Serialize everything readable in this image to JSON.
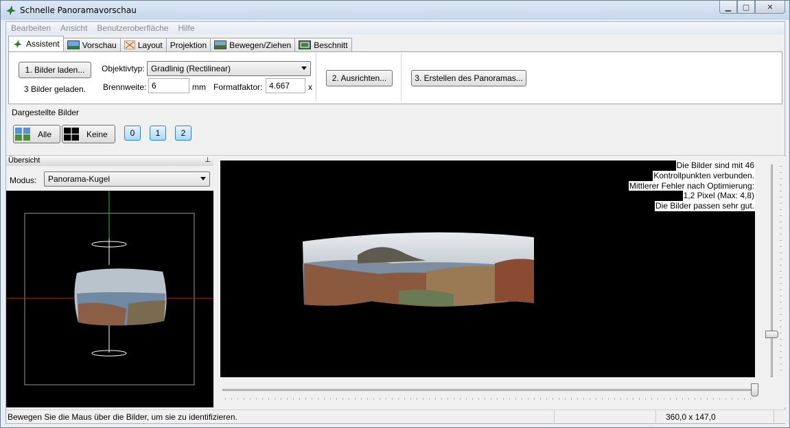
{
  "window": {
    "title": "Schnelle Panoramavorschau",
    "controls": {
      "minimize": "▁",
      "maximize": "▢",
      "close": "✕"
    }
  },
  "menubar": {
    "items": [
      "Bearbeiten",
      "Ansicht",
      "Benutzeroberfläche",
      "Hilfe"
    ]
  },
  "tabs": [
    {
      "label": "Assistent",
      "icon": "hugin-icon",
      "active": true
    },
    {
      "label": "Vorschau",
      "icon": "preview-landscape-icon"
    },
    {
      "label": "Layout",
      "icon": "layout-icon"
    },
    {
      "label": "Projektion",
      "icon": ""
    },
    {
      "label": "Bewegen/Ziehen",
      "icon": "move-drag-icon"
    },
    {
      "label": "Beschnitt",
      "icon": "crop-icon"
    }
  ],
  "assistant": {
    "load_button": "1. Bilder laden...",
    "loaded_status": "3 Bilder geladen.",
    "lens_type_label": "Objektivtyp:",
    "lens_type_value": "Gradlinig (Rectilinear)",
    "focal_length_label": "Brennweite:",
    "focal_length_value": "6",
    "focal_length_unit": "mm",
    "crop_factor_label": "Formatfaktor:",
    "crop_factor_value": "4.667",
    "crop_factor_unit": "x",
    "align_button": "2. Ausrichten...",
    "create_button": "3. Erstellen des Panoramas..."
  },
  "displayed_images": {
    "title": "Dargestellte Bilder",
    "all_button": "Alle",
    "none_button": "Keine",
    "image_buttons": [
      "0",
      "1",
      "2"
    ]
  },
  "overview": {
    "title": "Übersicht",
    "pin_icon": "pin-icon",
    "mode_label": "Modus:",
    "mode_value": "Panorama-Kugel"
  },
  "preview": {
    "info_lines": [
      "Die Bilder sind mit 46",
      "Kontrollpunkten verbunden.",
      "Mittlerer Fehler nach Optimierung:",
      "1,2 Pixel (Max: 4,8)",
      "Die Bilder passen sehr gut."
    ]
  },
  "statusbar": {
    "message": "Bewegen Sie die Maus über die Bilder, um sie zu identifizieren.",
    "field_of_view": "360,0 x 147,0"
  }
}
